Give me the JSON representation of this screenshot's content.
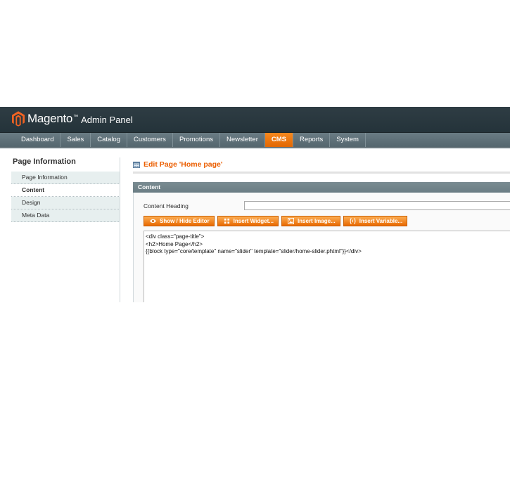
{
  "app": {
    "brand": "Magento",
    "brand_tm": "™",
    "brand_sub": "Admin Panel"
  },
  "nav": {
    "items": [
      "Dashboard",
      "Sales",
      "Catalog",
      "Customers",
      "Promotions",
      "Newsletter",
      "CMS",
      "Reports",
      "System"
    ],
    "active": "CMS"
  },
  "sidebar": {
    "title": "Page Information",
    "tabs": [
      "Page Information",
      "Content",
      "Design",
      "Meta Data"
    ],
    "active": "Content"
  },
  "page": {
    "title": "Edit Page 'Home page'"
  },
  "content_section": {
    "heading": "Content",
    "content_heading_label": "Content Heading",
    "content_heading_value": "",
    "buttons": {
      "show_hide": "Show / Hide Editor",
      "insert_widget": "Insert Widget...",
      "insert_image": "Insert Image...",
      "insert_variable": "Insert Variable..."
    },
    "editor_lines": [
      "<div class=\"page-title\">",
      "<h2>Home Page</h2>",
      "{{block type=\"core/template\" name=\"slider\" template=\"slider/home-slider.phtml\"}}</div>"
    ]
  },
  "colors": {
    "accent": "#eb5e00",
    "header_bg": "#2f3d44",
    "nav_bg": "#5e7078",
    "button": "#f18200"
  }
}
